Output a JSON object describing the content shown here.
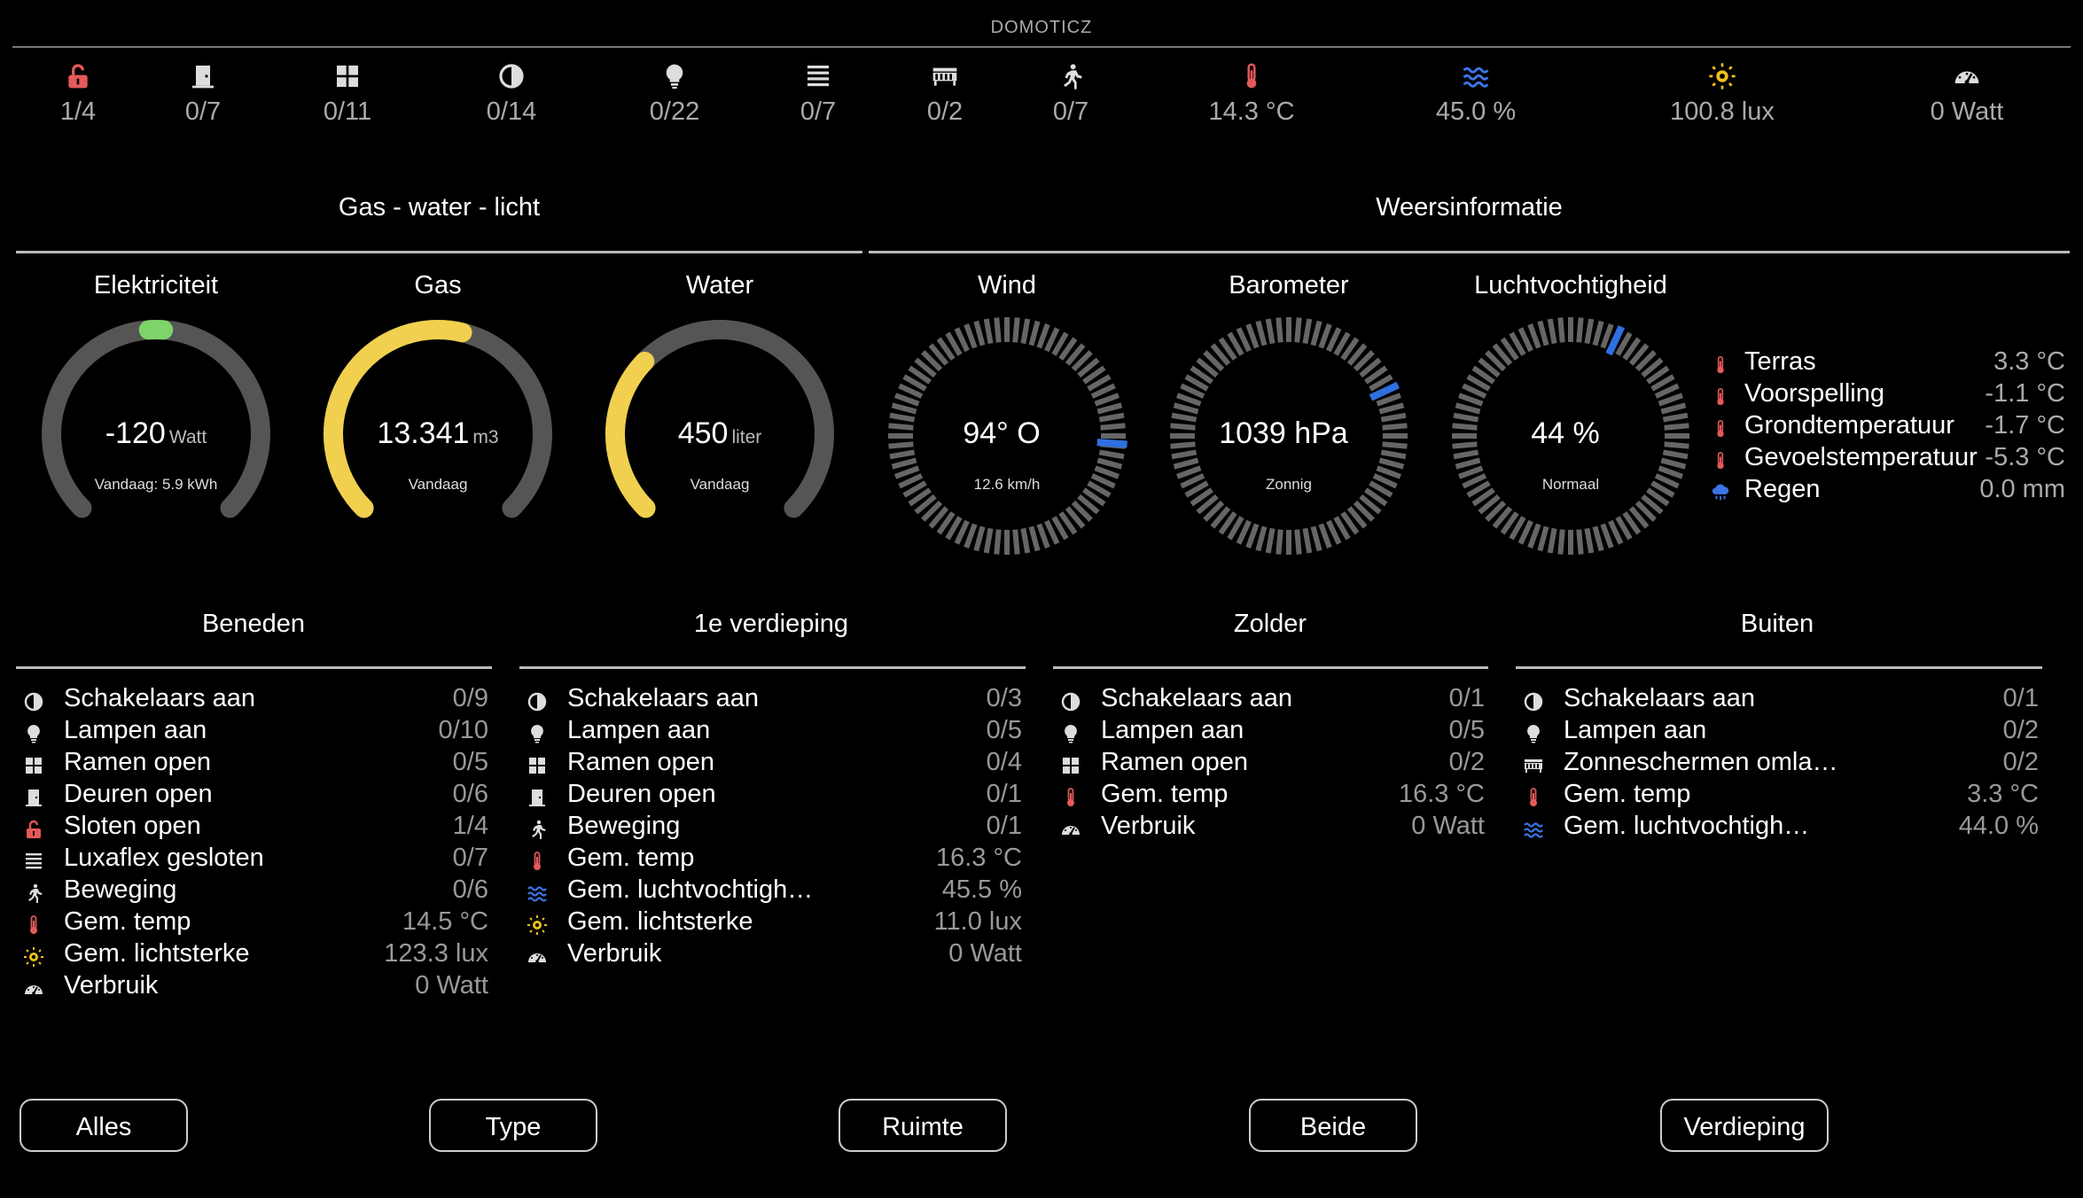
{
  "app": {
    "title": "DOMOTICZ"
  },
  "colors": {
    "accent_yellow": "#f0d04e",
    "accent_green": "#7ed36a",
    "needle_blue": "#2f6fe0",
    "red_icon": "#e45a5a",
    "track_gray": "#555555"
  },
  "summary": [
    {
      "icon": "lock-open-icon",
      "value": "1/4"
    },
    {
      "icon": "door-icon",
      "value": "0/7"
    },
    {
      "icon": "window-icon",
      "value": "0/11"
    },
    {
      "icon": "switch-icon",
      "value": "0/14"
    },
    {
      "icon": "bulb-icon",
      "value": "0/22"
    },
    {
      "icon": "blinds-icon",
      "value": "0/7"
    },
    {
      "icon": "awning-icon",
      "value": "0/2"
    },
    {
      "icon": "motion-icon",
      "value": "0/7"
    },
    {
      "icon": "thermometer-icon",
      "value": "14.3 °C"
    },
    {
      "icon": "humidity-icon",
      "value": "45.0 %"
    },
    {
      "icon": "sun-icon",
      "value": "100.8 lux"
    },
    {
      "icon": "speedometer-icon",
      "value": "0 Watt"
    }
  ],
  "sections": {
    "utilities": "Gas - water - licht",
    "weather": "Weersinformatie"
  },
  "gauges": [
    {
      "title": "Elektriciteit",
      "value": "-120",
      "unit": "Watt",
      "sub": "Vandaag: 5.9 kWh",
      "fill_fraction": 0.5,
      "marker": "green"
    },
    {
      "title": "Gas",
      "value": "13.341",
      "unit": "m3",
      "sub": "Vandaag",
      "fill_fraction": 0.55
    },
    {
      "title": "Water",
      "value": "450",
      "unit": "liter",
      "sub": "Vandaag",
      "fill_fraction": 0.33
    }
  ],
  "dials": [
    {
      "title": "Wind",
      "value": "94° O",
      "sub": "12.6 km/h",
      "needle_deg": 94
    },
    {
      "title": "Barometer",
      "value": "1039 hPa",
      "sub": "Zonnig",
      "needle_deg": 65
    },
    {
      "title": "Luchtvochtigheid",
      "value": "44 %",
      "sub": "Normaal",
      "needle_deg": 25
    }
  ],
  "weather_list": [
    {
      "icon": "thermometer-icon",
      "label": "Terras",
      "value": "3.3 °C"
    },
    {
      "icon": "thermometer-icon",
      "label": "Voorspelling",
      "value": "-1.1 °C"
    },
    {
      "icon": "thermometer-icon",
      "label": "Grondtemperatuur",
      "value": "-1.7 °C"
    },
    {
      "icon": "thermometer-icon",
      "label": "Gevoelstemperatuur",
      "value": "-5.3 °C"
    },
    {
      "icon": "rain-icon",
      "label": "Regen",
      "value": "0.0 mm"
    }
  ],
  "rooms": [
    {
      "title": "Beneden",
      "rows": [
        {
          "icon": "switch-icon",
          "label": "Schakelaars aan",
          "value": "0/9"
        },
        {
          "icon": "bulb-icon",
          "label": "Lampen aan",
          "value": "0/10"
        },
        {
          "icon": "window-icon",
          "label": "Ramen open",
          "value": "0/5"
        },
        {
          "icon": "door-icon",
          "label": "Deuren open",
          "value": "0/6"
        },
        {
          "icon": "lock-open-icon",
          "label": "Sloten open",
          "value": "1/4"
        },
        {
          "icon": "blinds-icon",
          "label": "Luxaflex gesloten",
          "value": "0/7"
        },
        {
          "icon": "motion-icon",
          "label": "Beweging",
          "value": "0/6"
        },
        {
          "icon": "thermometer-icon",
          "label": "Gem. temp",
          "value": "14.5 °C"
        },
        {
          "icon": "sun-icon",
          "label": "Gem. lichtsterke",
          "value": "123.3 lux"
        },
        {
          "icon": "speedometer-icon",
          "label": "Verbruik",
          "value": "0 Watt"
        }
      ]
    },
    {
      "title": "1e verdieping",
      "rows": [
        {
          "icon": "switch-icon",
          "label": "Schakelaars aan",
          "value": "0/3"
        },
        {
          "icon": "bulb-icon",
          "label": "Lampen aan",
          "value": "0/5"
        },
        {
          "icon": "window-icon",
          "label": "Ramen open",
          "value": "0/4"
        },
        {
          "icon": "door-icon",
          "label": "Deuren open",
          "value": "0/1"
        },
        {
          "icon": "motion-icon",
          "label": "Beweging",
          "value": "0/1"
        },
        {
          "icon": "thermometer-icon",
          "label": "Gem. temp",
          "value": "16.3 °C"
        },
        {
          "icon": "humidity-icon",
          "label": "Gem. luchtvochtigh…",
          "value": "45.5 %"
        },
        {
          "icon": "sun-icon",
          "label": "Gem. lichtsterke",
          "value": "11.0 lux"
        },
        {
          "icon": "speedometer-icon",
          "label": "Verbruik",
          "value": "0 Watt"
        }
      ]
    },
    {
      "title": "Zolder",
      "rows": [
        {
          "icon": "switch-icon",
          "label": "Schakelaars aan",
          "value": "0/1"
        },
        {
          "icon": "bulb-icon",
          "label": "Lampen aan",
          "value": "0/5"
        },
        {
          "icon": "window-icon",
          "label": "Ramen open",
          "value": "0/2"
        },
        {
          "icon": "thermometer-icon",
          "label": "Gem. temp",
          "value": "16.3 °C"
        },
        {
          "icon": "speedometer-icon",
          "label": "Verbruik",
          "value": "0 Watt"
        }
      ]
    },
    {
      "title": "Buiten",
      "rows": [
        {
          "icon": "switch-icon",
          "label": "Schakelaars aan",
          "value": "0/1"
        },
        {
          "icon": "bulb-icon",
          "label": "Lampen aan",
          "value": "0/2"
        },
        {
          "icon": "awning-icon",
          "label": "Zonneschermen omla…",
          "value": "0/2"
        },
        {
          "icon": "thermometer-icon",
          "label": "Gem. temp",
          "value": "3.3 °C"
        },
        {
          "icon": "humidity-icon",
          "label": "Gem. luchtvochtigh…",
          "value": "44.0 %"
        }
      ]
    }
  ],
  "buttons": [
    "Alles",
    "Type",
    "Ruimte",
    "Beide",
    "Verdieping"
  ]
}
